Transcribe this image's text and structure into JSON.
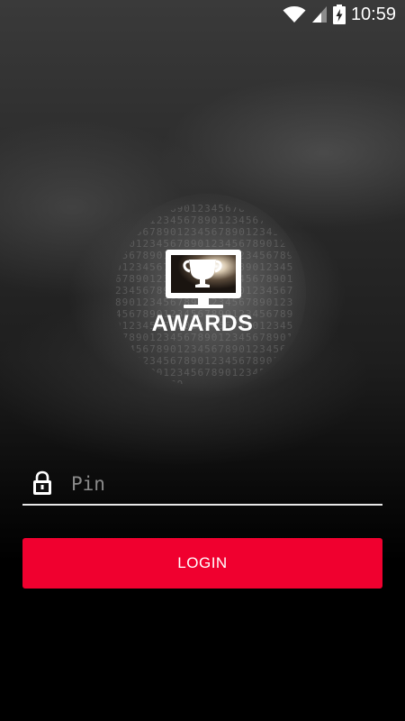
{
  "status_bar": {
    "time": "10:59",
    "icons": [
      "wifi-icon",
      "cell-signal-icon",
      "battery-charging-icon"
    ]
  },
  "logo": {
    "icon": "tv-trophy-icon",
    "text": "AWARDS"
  },
  "login_form": {
    "pin_icon": "lock-icon",
    "pin_placeholder": "Pin",
    "pin_value": "",
    "login_label": "LOGIN"
  },
  "colors": {
    "accent": "#f0002f",
    "background": "#000000",
    "text": "#ffffff",
    "placeholder": "#8a8a8a"
  }
}
